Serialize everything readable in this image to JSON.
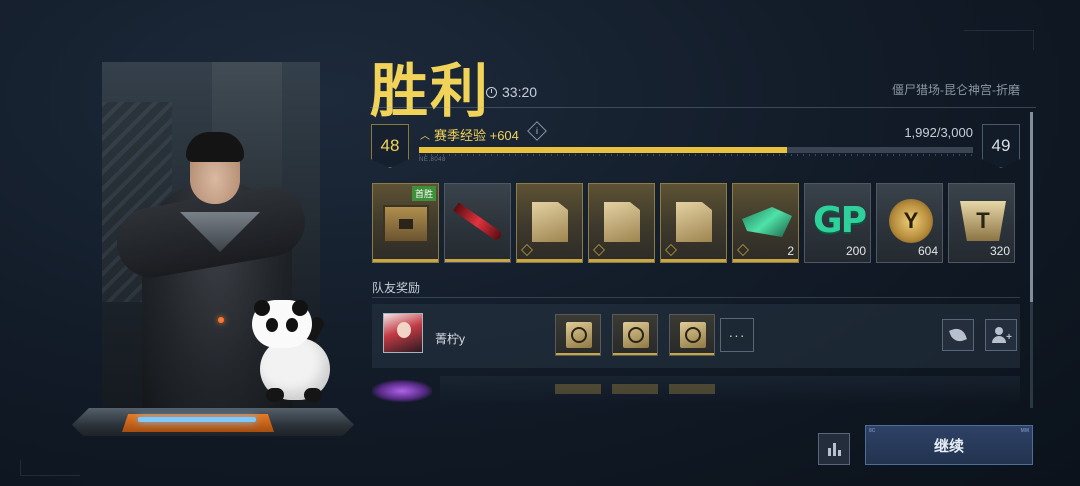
{
  "header": {
    "result_title": "胜利",
    "match_time": "33:20",
    "mode_path": "僵尸猎场-昆仑神宫-折磨"
  },
  "experience": {
    "current_level": "48",
    "next_level": "49",
    "label": "赛季经验 +604",
    "info_glyph": "i",
    "progress_text": "1,992/3,000",
    "progress_fraction": 0.664,
    "sub_code": "NE.8048"
  },
  "rewards": [
    {
      "name": "supply-crate",
      "amount": "",
      "tag": "首胜",
      "style": "gold"
    },
    {
      "name": "red-blade",
      "amount": "",
      "tag": "",
      "style": "plain"
    },
    {
      "name": "target-file",
      "amount": "",
      "tag": "",
      "style": "gold"
    },
    {
      "name": "ammo-file",
      "amount": "",
      "tag": "",
      "style": "gold"
    },
    {
      "name": "armor-file",
      "amount": "",
      "tag": "",
      "style": "gold"
    },
    {
      "name": "green-weapon",
      "amount": "2",
      "tag": "",
      "style": "gold"
    },
    {
      "name": "gp-points",
      "amount": "200",
      "tag": "",
      "style": "plain"
    },
    {
      "name": "y-coin",
      "amount": "604",
      "tag": "",
      "style": "plain"
    },
    {
      "name": "t-badge",
      "amount": "320",
      "tag": "",
      "style": "plain"
    }
  ],
  "reward_glyphs": {
    "gp": "GP",
    "y": "Y",
    "t": "T"
  },
  "team": {
    "section_title": "队友奖励",
    "teammate_name": "菁柠y",
    "more_label": "···"
  },
  "buttons": {
    "continue_label": "继续",
    "continue_corner_left": "8C",
    "continue_corner_right": "MM"
  },
  "colors": {
    "accent_gold": "#f1d35a",
    "exp_fill": "#e8c13f",
    "gp_green": "#2fd19b",
    "continue_bg": "#2e4266"
  }
}
